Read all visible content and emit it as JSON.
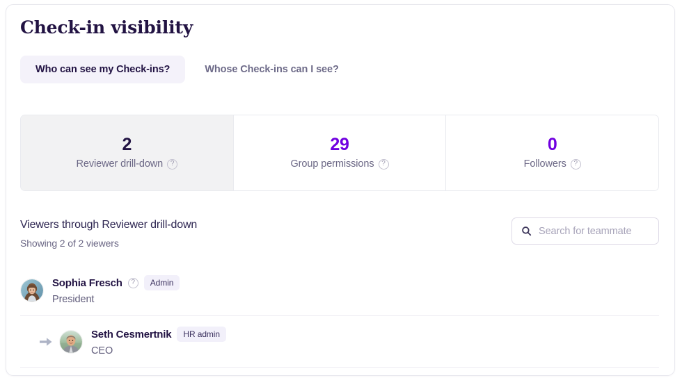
{
  "page": {
    "title": "Check-in visibility"
  },
  "tabs": [
    {
      "label": "Who can see my Check-ins?",
      "active": true
    },
    {
      "label": "Whose Check-ins can I see?",
      "active": false
    }
  ],
  "stats": [
    {
      "value": "2",
      "label": "Reviewer drill-down",
      "selected": true
    },
    {
      "value": "29",
      "label": "Group permissions",
      "selected": false
    },
    {
      "value": "0",
      "label": "Followers",
      "selected": false
    }
  ],
  "viewers": {
    "heading": "Viewers through Reviewer drill-down",
    "subheading": "Showing 2 of 2 viewers",
    "search": {
      "placeholder": "Search for teammate",
      "value": "",
      "icon": "search-icon"
    },
    "rows": [
      {
        "name": "Sophia Fresch",
        "badge": "Admin",
        "job_title": "President",
        "has_help_icon": true,
        "nested": false,
        "avatar": "woman-avatar"
      },
      {
        "name": "Seth Cesmertnik",
        "badge": "HR admin",
        "job_title": "CEO",
        "has_help_icon": false,
        "nested": true,
        "avatar": "man-avatar",
        "indent_icon": "arrow-right-icon"
      }
    ]
  },
  "icons": {
    "help": "?",
    "help_name": "help-circle-icon"
  },
  "colors": {
    "accent_purple": "#7000e0",
    "title_navy": "#221343",
    "muted": "#6b6785",
    "selected_card_bg": "#f2f2f3",
    "badge_bg": "#f2f0fa"
  }
}
